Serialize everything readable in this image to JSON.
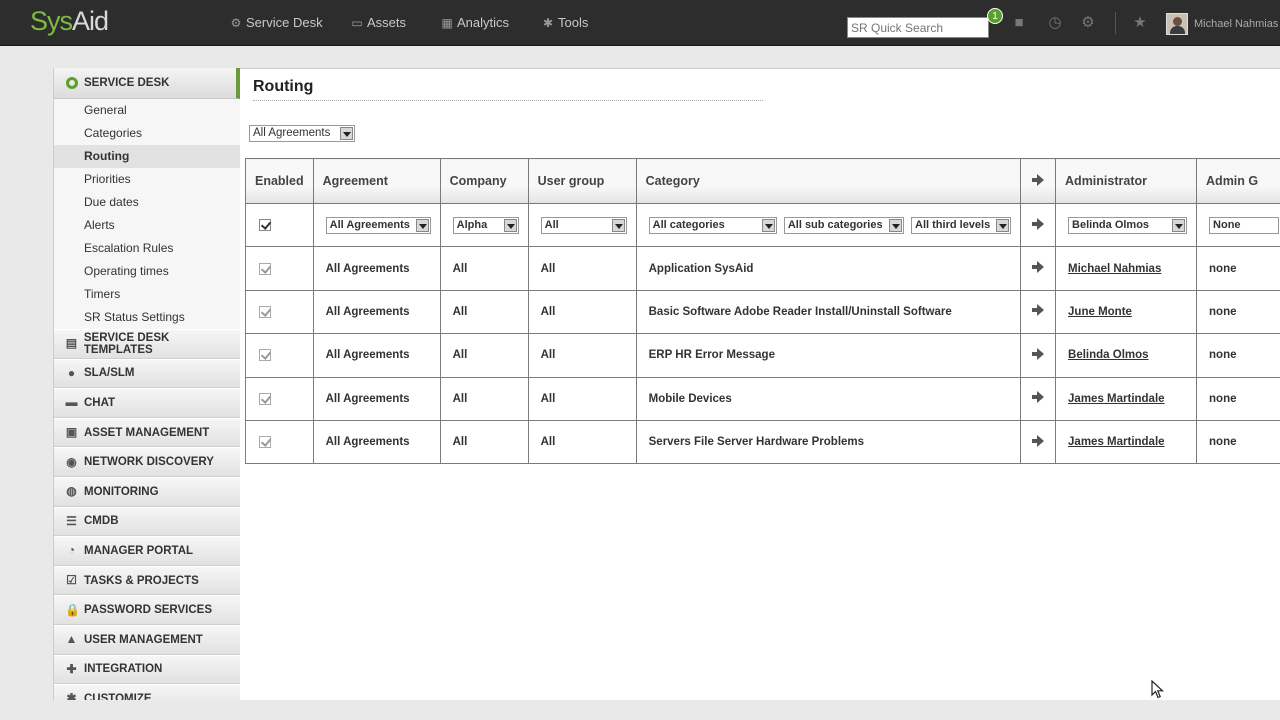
{
  "app": {
    "logo_sys": "Sys",
    "logo_aid": "Aid"
  },
  "topnav": {
    "items": [
      {
        "label": "Service Desk",
        "icon": "service-desk-icon"
      },
      {
        "label": "Assets",
        "icon": "monitor-icon"
      },
      {
        "label": "Analytics",
        "icon": "chart-icon"
      },
      {
        "label": "Tools",
        "icon": "tools-icon"
      }
    ],
    "search_placeholder": "SR Quick Search",
    "notification_count": "1",
    "user_name": "Michael Nahmias"
  },
  "sidebar": {
    "header": "SERVICE DESK",
    "sub_items": [
      {
        "label": "General",
        "active": false
      },
      {
        "label": "Categories",
        "active": false
      },
      {
        "label": "Routing",
        "active": true
      },
      {
        "label": "Priorities",
        "active": false
      },
      {
        "label": "Due dates",
        "active": false
      },
      {
        "label": "Alerts",
        "active": false
      },
      {
        "label": "Escalation Rules",
        "active": false
      },
      {
        "label": "Operating times",
        "active": false
      },
      {
        "label": "Timers",
        "active": false
      },
      {
        "label": "SR Status Settings",
        "active": false
      }
    ],
    "sections": [
      {
        "label": "SERVICE DESK TEMPLATES",
        "icon": "template-icon",
        "glyph": "▤"
      },
      {
        "label": "SLA/SLM",
        "icon": "lightbulb-icon",
        "glyph": "●"
      },
      {
        "label": "CHAT",
        "icon": "chat-icon",
        "glyph": "▬"
      },
      {
        "label": "ASSET MANAGEMENT",
        "icon": "asset-icon",
        "glyph": "▣"
      },
      {
        "label": "NETWORK DISCOVERY",
        "icon": "network-icon",
        "glyph": "◉"
      },
      {
        "label": "MONITORING",
        "icon": "eye-icon",
        "glyph": "◍"
      },
      {
        "label": "CMDB",
        "icon": "database-icon",
        "glyph": "☰"
      },
      {
        "label": "MANAGER PORTAL",
        "icon": "portal-icon",
        "glyph": "◔"
      },
      {
        "label": "TASKS & PROJECTS",
        "icon": "tasks-icon",
        "glyph": "☑"
      },
      {
        "label": "PASSWORD SERVICES",
        "icon": "lock-icon",
        "glyph": "🔒"
      },
      {
        "label": "USER MANAGEMENT",
        "icon": "user-icon",
        "glyph": "▲"
      },
      {
        "label": "INTEGRATION",
        "icon": "integration-icon",
        "glyph": "✚"
      },
      {
        "label": "CUSTOMIZE",
        "icon": "customize-icon",
        "glyph": "✱"
      }
    ]
  },
  "main": {
    "title": "Routing",
    "agreement_filter": "All Agreements",
    "columns": [
      "Enabled",
      "Agreement",
      "Company",
      "User group",
      "Category",
      "",
      "Administrator",
      "Admin G"
    ],
    "filter_row": {
      "agreement": "All Agreements",
      "company": "Alpha",
      "user_group": "All",
      "category": "All categories",
      "sub_category": "All sub categories",
      "third_level": "All third levels",
      "administrator": "Belinda Olmos",
      "admin_group": "None"
    },
    "rows": [
      {
        "agreement": "All Agreements",
        "company": "All",
        "user_group": "All",
        "category": "Application SysAid",
        "administrator": "Michael Nahmias",
        "admin_group": "none"
      },
      {
        "agreement": "All Agreements",
        "company": "All",
        "user_group": "All",
        "category": "Basic Software Adobe Reader Install/Uninstall Software",
        "administrator": "June Monte",
        "admin_group": "none"
      },
      {
        "agreement": "All Agreements",
        "company": "All",
        "user_group": "All",
        "category": "ERP HR Error Message",
        "administrator": "Belinda Olmos",
        "admin_group": "none"
      },
      {
        "agreement": "All Agreements",
        "company": "All",
        "user_group": "All",
        "category": "Mobile Devices",
        "administrator": "James Martindale",
        "admin_group": "none"
      },
      {
        "agreement": "All Agreements",
        "company": "All",
        "user_group": "All",
        "category": "Servers File Server Hardware Problems",
        "administrator": "James Martindale",
        "admin_group": "none"
      }
    ]
  }
}
